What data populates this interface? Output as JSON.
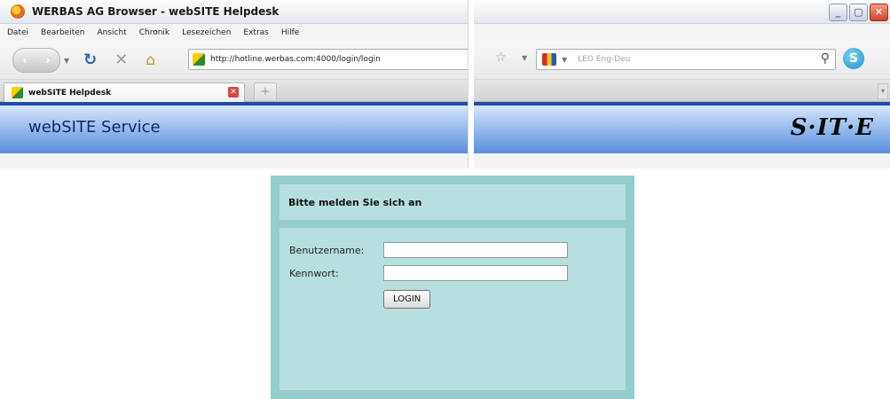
{
  "window": {
    "title": "WERBAS AG Browser - webSITE Helpdesk",
    "controls": {
      "minimize": "_",
      "maximize": "▢",
      "close": "✕"
    }
  },
  "menu": [
    "Datei",
    "Bearbeiten",
    "Ansicht",
    "Chronik",
    "Lesezeichen",
    "Extras",
    "Hilfe"
  ],
  "navigation": {
    "url": "http://hotline.werbas.com:4000/login/login",
    "search_placeholder": "LEO Eng-Deu",
    "icons": [
      "back-icon",
      "forward-icon",
      "reload-icon",
      "stop-icon",
      "home-icon",
      "bookmark-star-icon",
      "search-icon",
      "skype-icon"
    ]
  },
  "tabs": [
    {
      "label": "webSITE Helpdesk",
      "active": true
    }
  ],
  "page": {
    "header_title": "webSITE Service",
    "brand_logo": "S·IT·E"
  },
  "login": {
    "heading": "Bitte melden Sie sich an",
    "username_label": "Benutzername:",
    "username_value": "",
    "password_label": "Kennwort:",
    "password_value": "",
    "button_label": "LOGIN"
  },
  "colors": {
    "header_gradient_start": "#d7e6fb",
    "header_gradient_end": "#5a8fde",
    "header_border": "#1f4ea8",
    "login_outer": "#93cdcd",
    "login_inner": "#b8dfdf"
  }
}
